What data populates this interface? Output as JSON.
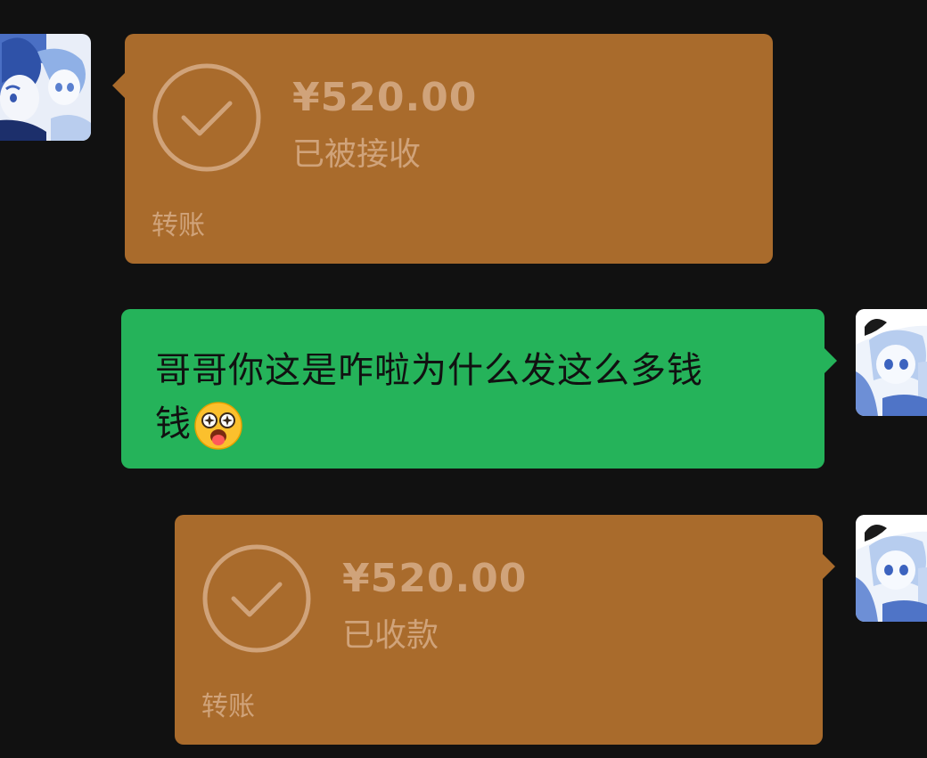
{
  "messages": [
    {
      "type": "transfer",
      "side": "left",
      "amount": "¥520.00",
      "status": "已被接收",
      "label": "转账",
      "avatar": "anime-avatar-boy"
    },
    {
      "type": "text",
      "side": "right",
      "line1": "哥哥你这是咋啦为什么发这么多钱",
      "line2": "钱",
      "emoji": "star-struck-tongue-emoji",
      "avatar": "anime-avatar-girl"
    },
    {
      "type": "transfer",
      "side": "right",
      "amount": "¥520.00",
      "status": "已收款",
      "label": "转账",
      "avatar": "anime-avatar-girl"
    }
  ],
  "colors": {
    "background": "#111111",
    "transfer_bubble": "#a96b2c",
    "transfer_text": "#d0a37a",
    "text_bubble": "#25b35a",
    "message_text": "#111111"
  }
}
